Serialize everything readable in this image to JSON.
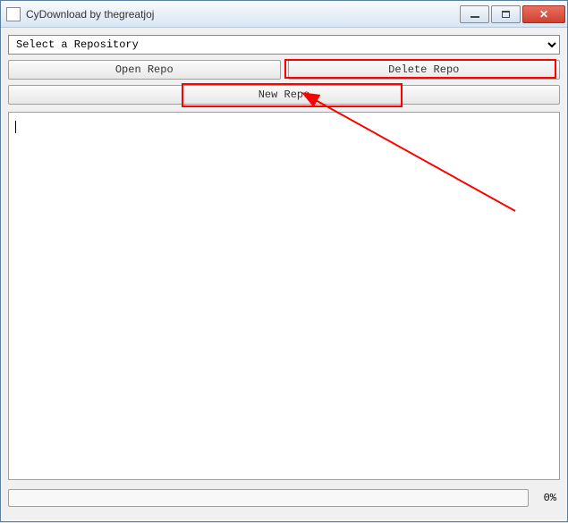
{
  "window": {
    "title": "CyDownload by thegreatjoj"
  },
  "repo_select": {
    "placeholder": "Select a Repository"
  },
  "buttons": {
    "open": "Open Repo",
    "delete": "Delete Repo",
    "new": "New Repo"
  },
  "textarea": {
    "value": ""
  },
  "progress": {
    "percent_label": "0%"
  },
  "window_controls": {
    "minimize": "minimize",
    "maximize": "maximize",
    "close": "close"
  },
  "annotations": {
    "highlight_delete": true,
    "highlight_new": true,
    "arrow_to_new": true
  }
}
